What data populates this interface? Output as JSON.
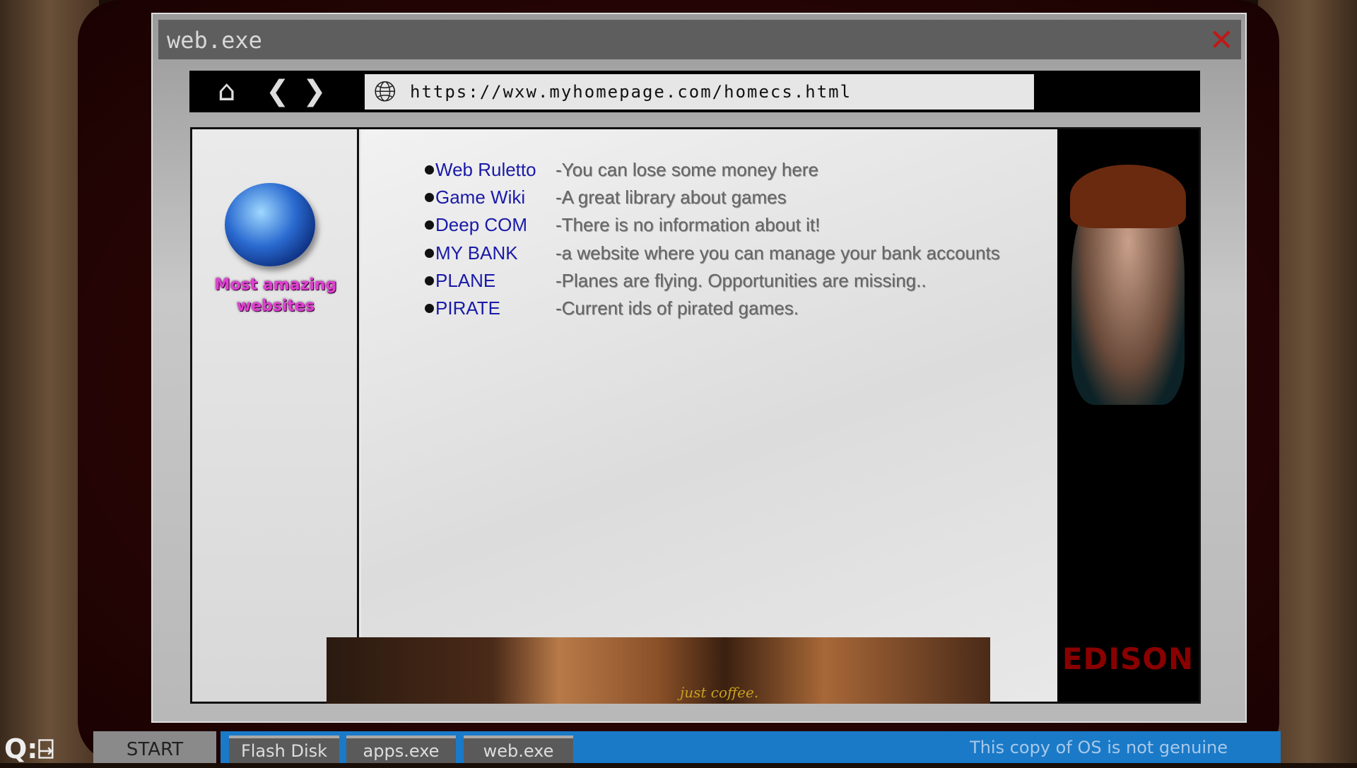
{
  "window": {
    "title": "web.exe",
    "close_icon": "close-x"
  },
  "nav": {
    "home_icon": "home",
    "back_icon": "chevron-left",
    "forward_icon": "chevron-right",
    "url": "https://wxw.myhomepage.com/homecs.html",
    "globe_icon": "globe"
  },
  "sidebar": {
    "tagline_line1": "Most amazing",
    "tagline_line2": "websites"
  },
  "links": [
    {
      "name": "Web Ruletto",
      "desc": "-You can lose some money here"
    },
    {
      "name": "Game Wiki",
      "desc": "-A great library about games"
    },
    {
      "name": "Deep COM",
      "desc": "-There is no information about it!"
    },
    {
      "name": "MY BANK",
      "desc": "-a website where you can manage your bank accounts"
    },
    {
      "name": "PLANE",
      "desc": "-Planes are flying. Opportunities are missing.."
    },
    {
      "name": "PIRATE",
      "desc": "-Current ids of pirated games."
    }
  ],
  "ads": {
    "right_brand": "EDISON",
    "banner_caption": "just coffee."
  },
  "taskbar": {
    "start": "START",
    "items": [
      "Flash Disk",
      "apps.exe",
      "web.exe"
    ],
    "notice": "This copy of OS is not genuine"
  },
  "hud": {
    "quit_hint": "Q:"
  },
  "colors": {
    "link": "#1a1aa8",
    "taskbar": "#1a7ac8",
    "close": "#c01818"
  }
}
